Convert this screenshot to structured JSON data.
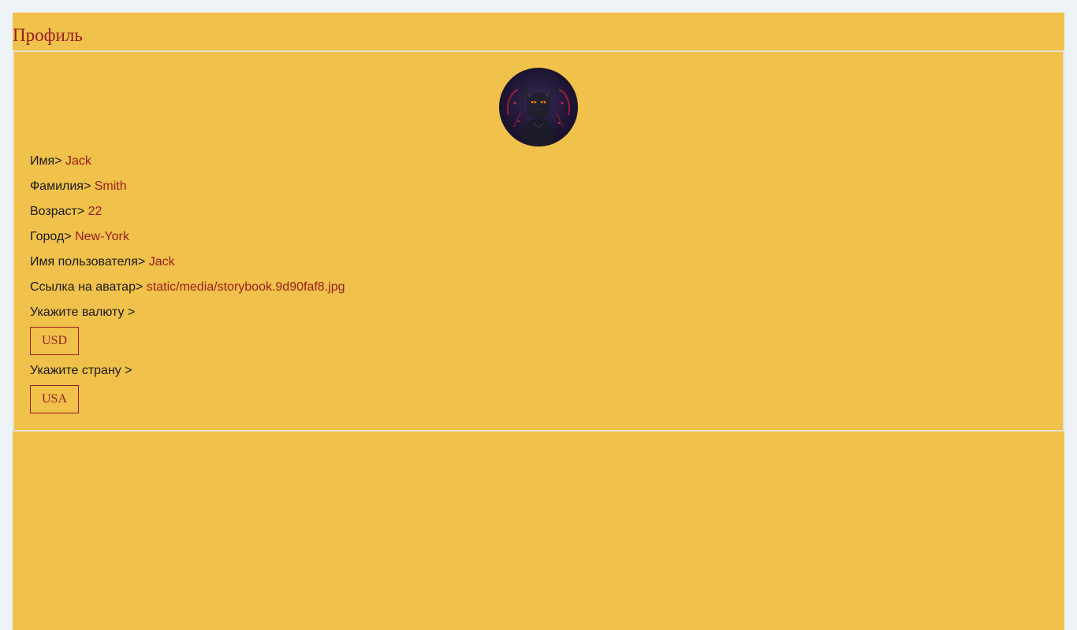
{
  "page": {
    "title": "Профиль",
    "colors": {
      "background": "#f0c14b",
      "accent": "#9b1c1c",
      "outer_background": "#eef3f7"
    }
  },
  "profile": {
    "avatar_icon": "black-cat-avatar",
    "fields": {
      "first_name": {
        "label": "Имя>",
        "value": "Jack"
      },
      "last_name": {
        "label": "Фамилия>",
        "value": "Smith"
      },
      "age": {
        "label": "Возраст>",
        "value": "22"
      },
      "city": {
        "label": "Город>",
        "value": "New-York"
      },
      "username": {
        "label": "Имя пользователя>",
        "value": "Jack"
      },
      "avatar_link": {
        "label": "Ссылка на аватар>",
        "value": "static/media/storybook.9d90faf8.jpg"
      }
    },
    "currency": {
      "label": "Укажите валюту >",
      "selected": "USD"
    },
    "country": {
      "label": "Укажите страну >",
      "selected": "USA"
    }
  }
}
